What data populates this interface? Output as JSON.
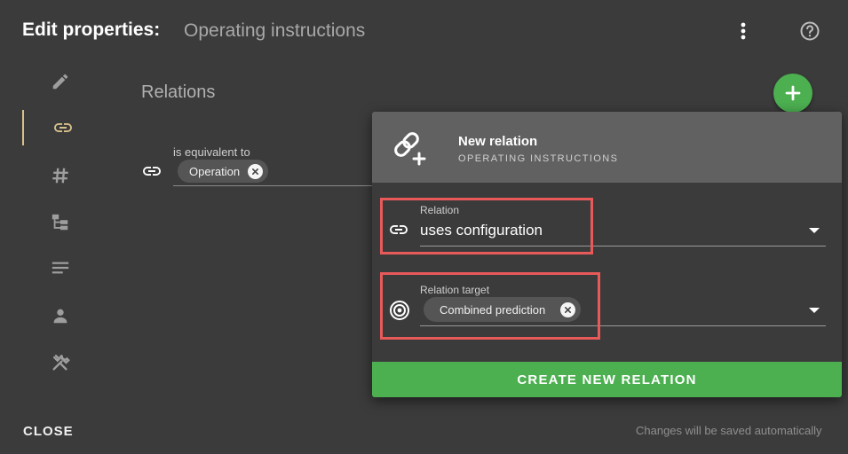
{
  "header": {
    "title": "Edit properties:",
    "subtitle": "Operating instructions"
  },
  "sidebar": {
    "items": [
      {
        "icon": "pencil-icon"
      },
      {
        "icon": "link-icon",
        "active": true
      },
      {
        "icon": "hash-icon"
      },
      {
        "icon": "hierarchy-icon"
      },
      {
        "icon": "text-lines-icon"
      },
      {
        "icon": "person-icon"
      },
      {
        "icon": "tools-icon"
      }
    ]
  },
  "main": {
    "section_title": "Relations",
    "relation": {
      "label": "is equivalent to",
      "chip": "Operation"
    }
  },
  "panel": {
    "title": "New relation",
    "subtitle": "OPERATING INSTRUCTIONS",
    "relation_field": {
      "label": "Relation",
      "value": "uses configuration"
    },
    "target_field": {
      "label": "Relation target",
      "chip": "Combined prediction"
    },
    "create_button": "CREATE NEW RELATION"
  },
  "footer": {
    "close_label": "CLOSE",
    "note": "Changes will be saved automatically"
  },
  "colors": {
    "background": "#3b3b3b",
    "accent_green": "#4caf50",
    "active_indicator": "#d8c08a",
    "highlight_red": "#e85a5a",
    "panel_header": "#616161"
  }
}
